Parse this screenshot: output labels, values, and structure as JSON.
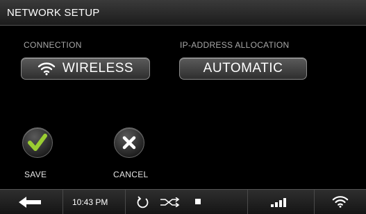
{
  "header": {
    "title": "NETWORK SETUP"
  },
  "connection": {
    "label": "CONNECTION",
    "value": "WIRELESS",
    "icon": "wifi-icon"
  },
  "ip_allocation": {
    "label": "IP-ADDRESS ALLOCATION",
    "value": "AUTOMATIC"
  },
  "actions": {
    "save_label": "SAVE",
    "cancel_label": "CANCEL",
    "save_icon_color": "#9acd32"
  },
  "status_bar": {
    "time": "10:43 PM",
    "icons": [
      "back-arrow-icon",
      "repeat-icon",
      "shuffle-icon",
      "stop-icon",
      "signal-strength-icon",
      "wifi-icon"
    ]
  }
}
